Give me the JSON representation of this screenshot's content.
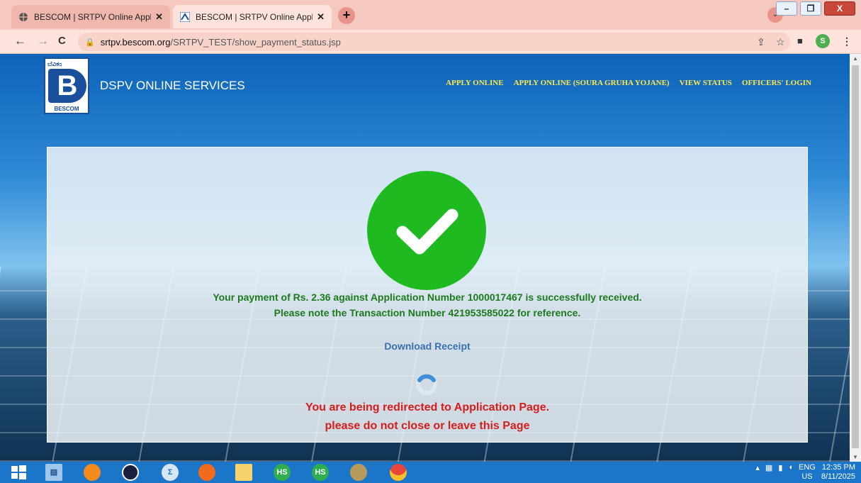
{
  "browser": {
    "tabs": [
      {
        "title": "BESCOM | SRTPV Online Applicat",
        "active": false
      },
      {
        "title": "BESCOM | SRTPV Online Applicat",
        "active": true
      }
    ],
    "new_tab_label": "+",
    "tab_close_label": "✕",
    "nav": {
      "back": "←",
      "forward": "→",
      "reload": "C"
    },
    "url": {
      "host": "srtpv.bescom.org",
      "path": "/SRTPV_TEST/show_payment_status.jsp"
    },
    "profile_initial": "S",
    "window": {
      "minimize": "–",
      "restore": "❐",
      "close": "X"
    }
  },
  "site": {
    "logo_kannada": "ಬೆವಿಕಂ",
    "logo_mark": "B",
    "logo_brand": "BESCOM",
    "title": "DSPV ONLINE SERVICES",
    "nav": [
      "APPLY ONLINE",
      "APPLY ONLINE (SOURA GRUHA YOJANE)",
      "VIEW STATUS",
      "OFFICERS' LOGIN"
    ]
  },
  "status": {
    "success_line1": "Your payment of Rs. 2.36 against Application Number 1000017467 is successfully received.",
    "success_line2": "Please note the Transaction Number 421953585022 for reference.",
    "download_label": "Download Receipt",
    "redirect_line1": "You are being redirected to Application Page.",
    "redirect_line2": "please do not close or leave this Page"
  },
  "taskbar": {
    "hs_label": "HS",
    "lang_top": "ENG",
    "lang_bottom": "US",
    "time": "12:35 PM",
    "date": "8/11/2025"
  },
  "colors": {
    "success_green": "#1fba1f",
    "message_green": "#1d7a1d",
    "redirect_red": "#d71c1c",
    "nav_yellow": "#ffe74a",
    "link_blue": "#3c6fb0"
  }
}
